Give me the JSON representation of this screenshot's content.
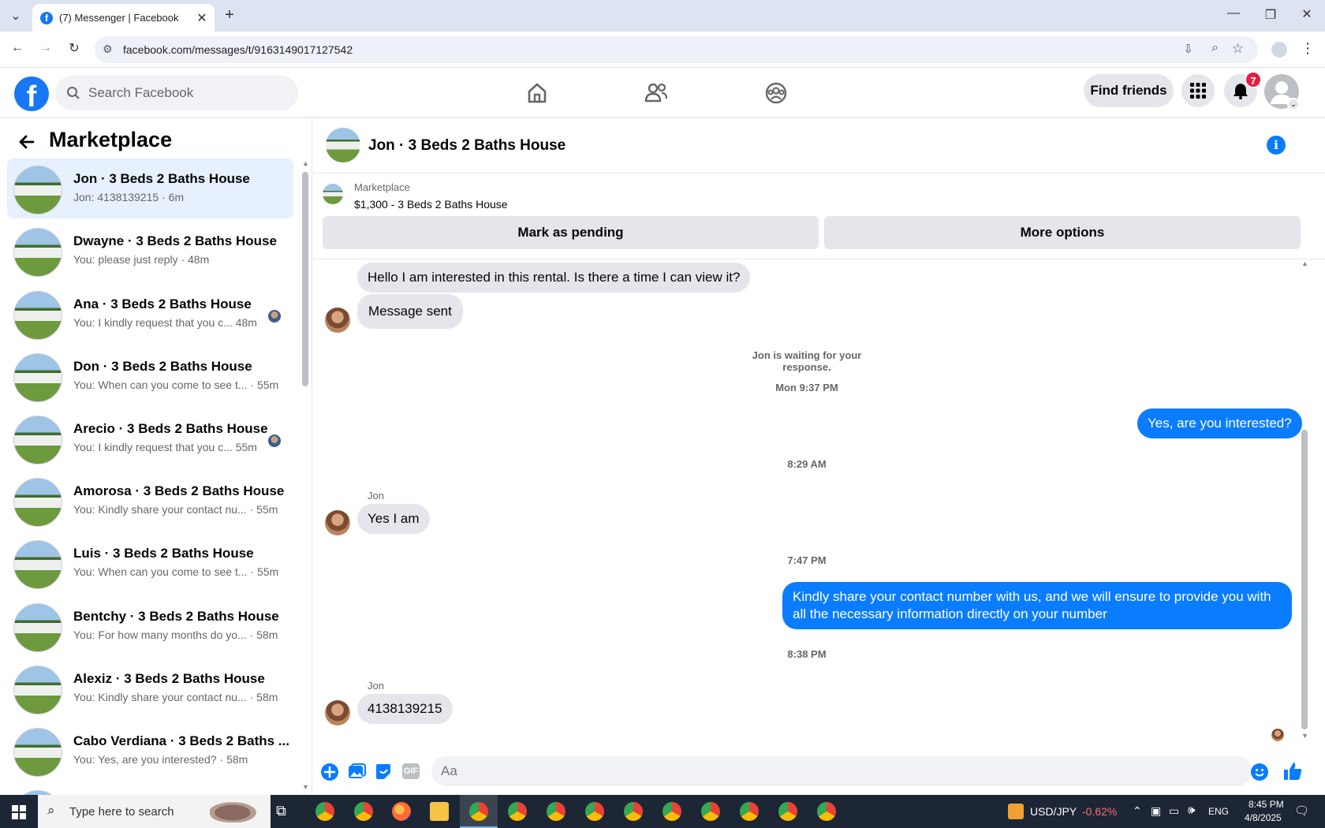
{
  "browser": {
    "tab_title": "(7) Messenger | Facebook",
    "url": "facebook.com/messages/t/9163149017127542"
  },
  "fb_header": {
    "search_placeholder": "Search Facebook",
    "find_friends": "Find friends",
    "notifications_count": "7"
  },
  "sidebar": {
    "title": "Marketplace",
    "conversations": [
      {
        "name": "Jon · 3 Beds 2 Baths House",
        "preview": "Jon: 4138139215 · 6m"
      },
      {
        "name": "Dwayne · 3 Beds 2 Baths House",
        "preview": "You: please just reply · 48m"
      },
      {
        "name": "Ana · 3 Beds 2 Baths House",
        "preview": "You: I kindly request that you c...  48m"
      },
      {
        "name": "Don · 3 Beds 2 Baths House",
        "preview": "You: When can you come to see t... · 55m"
      },
      {
        "name": "Arecio · 3 Beds 2 Baths House",
        "preview": "You: I kindly request that you c...  55m"
      },
      {
        "name": "Amorosa · 3 Beds 2 Baths House",
        "preview": "You: Kindly share your contact nu... · 55m"
      },
      {
        "name": "Luis · 3 Beds 2 Baths House",
        "preview": "You: When can you come to see t... · 55m"
      },
      {
        "name": "Bentchy · 3 Beds 2 Baths House",
        "preview": "You: For how many months do yo... · 58m"
      },
      {
        "name": "Alexiz · 3 Beds 2 Baths House",
        "preview": "You: Kindly share your contact nu... · 58m"
      },
      {
        "name": "Cabo Verdiana · 3 Beds 2 Baths ...",
        "preview": "You: Yes, are you interested? · 58m"
      }
    ]
  },
  "chat": {
    "title": "Jon · 3 Beds 2 Baths House",
    "listing_source": "Marketplace",
    "listing_price": "$1,300 - 3 Beds 2 Baths House",
    "mark_pending": "Mark as pending",
    "more_options": "More options",
    "messages": {
      "m1": "Hello I am interested in this rental. Is there a time I can view it?",
      "m2": "Message sent",
      "waiting": "Jon is waiting for your response.",
      "t1": "Mon 9:37 PM",
      "m3": "Yes, are you interested?",
      "t2": "8:29 AM",
      "sender1": "Jon",
      "m4": "Yes I am",
      "t3": "7:47 PM",
      "m5": "Kindly share your contact number with us, and we will ensure to provide you with all the necessary information directly on your number",
      "t4": "8:38 PM",
      "sender2": "Jon",
      "m6": "4138139215"
    },
    "composer_placeholder": "Aa",
    "gif_label": "GIF"
  },
  "taskbar": {
    "search_placeholder": "Type here to search",
    "ticker_name": "USD/JPY",
    "ticker_change": "-0.62%",
    "language": "ENG",
    "time": "8:45 PM",
    "date": "4/8/2025"
  },
  "colors": {
    "fb_blue": "#1877f2",
    "messenger_blue": "#0a7cff",
    "negative": "#ff6b6b"
  }
}
